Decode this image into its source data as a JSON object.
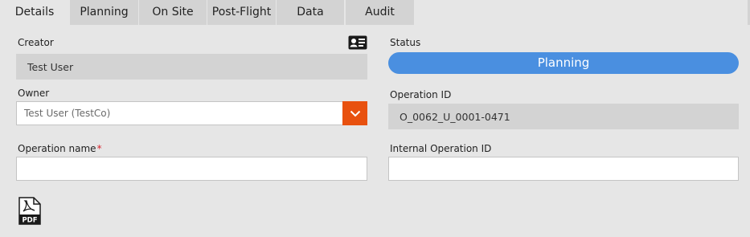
{
  "tabs": [
    {
      "label": "Details",
      "active": true
    },
    {
      "label": "Planning",
      "active": false
    },
    {
      "label": "On Site",
      "active": false
    },
    {
      "label": "Post-Flight",
      "active": false
    },
    {
      "label": "Data",
      "active": false
    },
    {
      "label": "Audit",
      "active": false
    }
  ],
  "creator": {
    "label": "Creator",
    "value": "Test User",
    "icon": "contact-card-icon"
  },
  "status": {
    "label": "Status",
    "value": "Planning",
    "color": "#4a8fe0"
  },
  "owner": {
    "label": "Owner",
    "value": "Test User (TestCo)",
    "dropdown_color": "#e8510f"
  },
  "operation_id": {
    "label": "Operation ID",
    "value": "O_0062_U_0001-0471"
  },
  "operation_name": {
    "label": "Operation name",
    "required_mark": "*",
    "value": ""
  },
  "internal_operation_id": {
    "label": "Internal Operation ID",
    "value": ""
  },
  "pdf": {
    "icon": "pdf-file-icon",
    "label": "PDF"
  }
}
